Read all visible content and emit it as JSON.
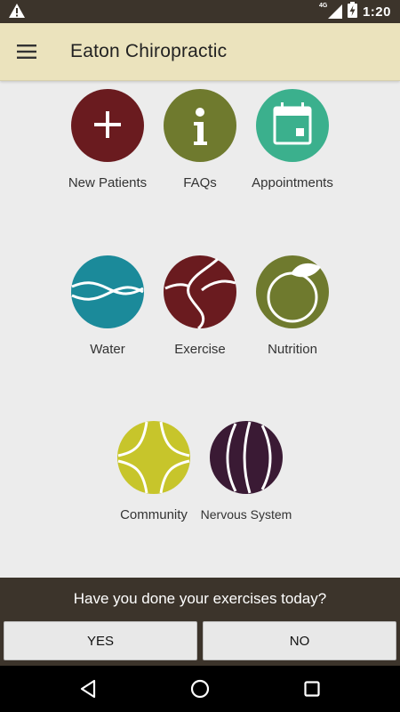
{
  "status_bar": {
    "network": "4G",
    "time": "1:20",
    "icons": [
      "warning-icon",
      "signal-icon",
      "battery-charging-icon"
    ]
  },
  "app_bar": {
    "menu_icon": "hamburger-menu-icon",
    "title": "Eaton Chiropractic"
  },
  "tiles": [
    {
      "label": "New Patients",
      "icon": "plus-icon",
      "color": "#6a1b1f"
    },
    {
      "label": "FAQs",
      "icon": "info-icon",
      "color": "#6f7a2e"
    },
    {
      "label": "Appointments",
      "icon": "calendar-icon",
      "color": "#3bb08d"
    },
    {
      "label": "Water",
      "icon": "water-waves-icon",
      "color": "#1b8a9a"
    },
    {
      "label": "Exercise",
      "icon": "exercise-ball-icon",
      "color": "#6a1b1f"
    },
    {
      "label": "Nutrition",
      "icon": "nutrition-leaf-icon",
      "color": "#6f7a2e"
    },
    {
      "label": "Community",
      "icon": "community-ball-icon",
      "color": "#c7c52b"
    },
    {
      "label": "Nervous System",
      "icon": "nervous-system-icon",
      "color": "#3a1a34"
    }
  ],
  "prompt": {
    "question": "Have you done your exercises today?",
    "yes_label": "YES",
    "no_label": "NO",
    "background": "#3c342b"
  },
  "nav_bar": {
    "icons": [
      "back-icon",
      "home-icon",
      "recents-icon"
    ]
  }
}
